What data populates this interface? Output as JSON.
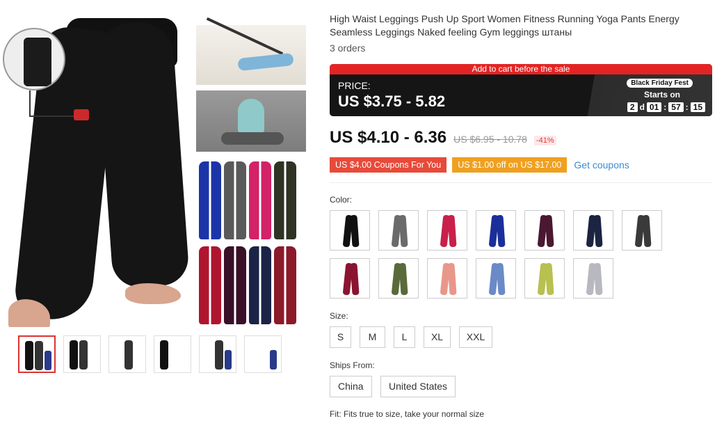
{
  "product": {
    "title": "High Waist Leggings Push Up Sport Women Fitness Running Yoga Pants Energy Seamless Leggings Naked feeling Gym leggings штаны",
    "orders": "3 orders"
  },
  "promo": {
    "banner": "Add to cart before the sale",
    "price_label": "PRICE:",
    "price": "US $3.75 - 5.82",
    "badge": "Black Friday Fest",
    "starts_on": "Starts on",
    "countdown": {
      "days": "2",
      "d": "d",
      "hours": "01",
      "minutes": "57",
      "seconds": "15"
    }
  },
  "pricing": {
    "current": "US $4.10 - 6.36",
    "original": "US $6.95 - 10.78",
    "discount": "-41%"
  },
  "coupons": {
    "coupon1": "US $4.00 Coupons For You",
    "coupon2": "US $1.00 off on US $17.00",
    "link": "Get coupons"
  },
  "options": {
    "color_label": "Color:",
    "color_swatches": [
      "#111111",
      "#6b6b6b",
      "#c8204a",
      "#1b2f9a",
      "#4a1830",
      "#1b2440",
      "#3a3a3a",
      "#8a1530",
      "#5a6a3a",
      "#e8978a",
      "#6a8ac8",
      "#b8c050",
      "#b8b8c0"
    ],
    "size_label": "Size:",
    "sizes": [
      "S",
      "M",
      "L",
      "XL",
      "XXL"
    ],
    "ships_label": "Ships From:",
    "ships_from": [
      "China",
      "United States"
    ],
    "fit": "Fit: Fits true to size, take your normal size"
  },
  "gallery": {
    "pant_colors": [
      "#1b35a8",
      "#5a5a5a",
      "#d32268",
      "#2f3324",
      "#b01530",
      "#3a1028",
      "#1b2446",
      "#8c1a2a"
    ],
    "thumb_count": 6
  }
}
